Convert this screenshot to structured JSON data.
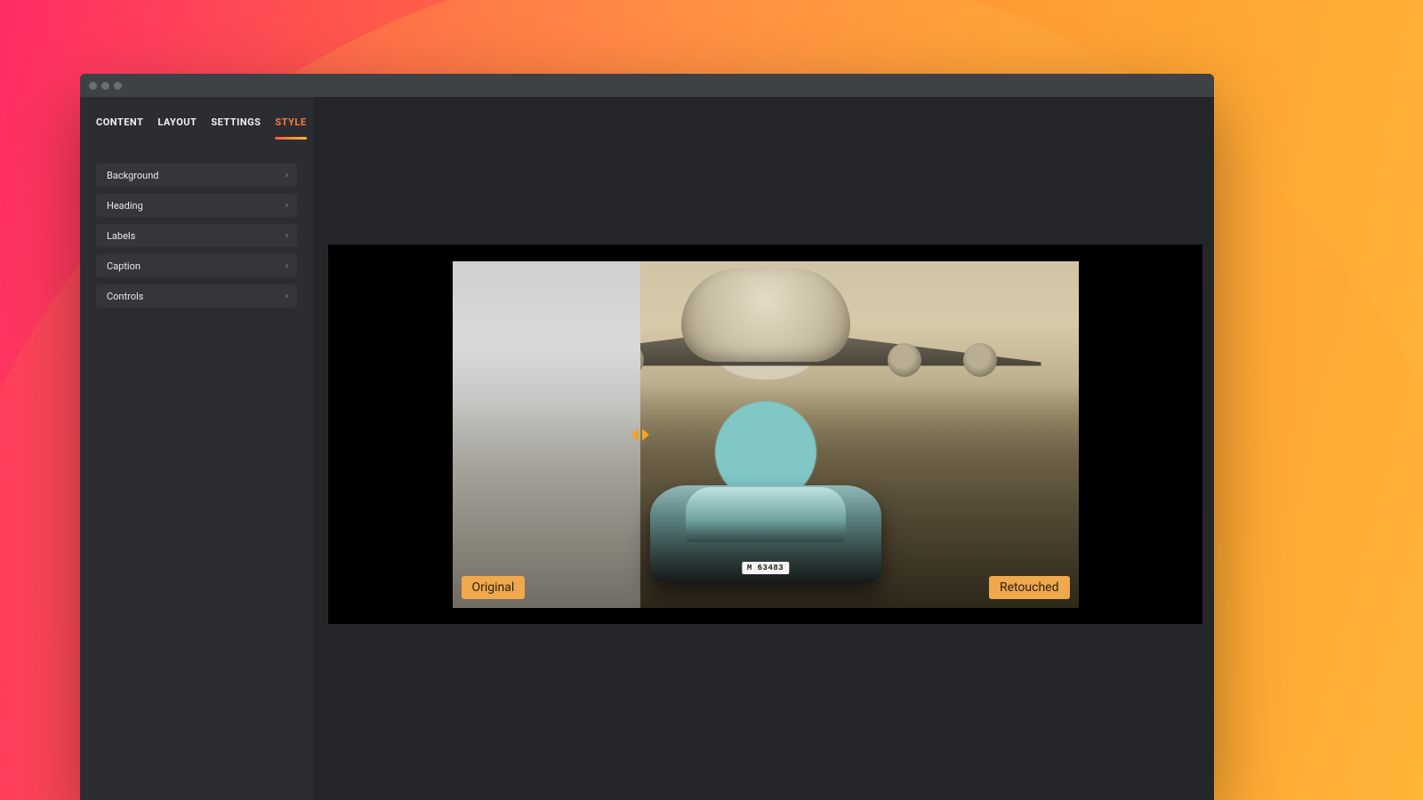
{
  "sidebar": {
    "tabs": [
      {
        "label": "CONTENT"
      },
      {
        "label": "LAYOUT"
      },
      {
        "label": "SETTINGS"
      },
      {
        "label": "STYLE"
      }
    ],
    "active_tab_index": 3,
    "accordion": [
      {
        "label": "Background"
      },
      {
        "label": "Heading"
      },
      {
        "label": "Labels"
      },
      {
        "label": "Caption"
      },
      {
        "label": "Controls"
      }
    ]
  },
  "comparison": {
    "left_label": "Original",
    "right_label": "Retouched",
    "divider_position_percent": 30,
    "plate_text": "M 63483"
  },
  "colors": {
    "accent": "#ff7a3c",
    "handle": "#f5a123",
    "label_chip_bg": "#f0a84d"
  }
}
